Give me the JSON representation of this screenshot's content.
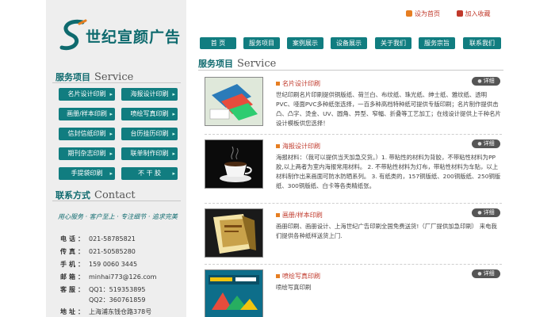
{
  "brand": {
    "name": "世纪宣颜广告"
  },
  "top_links": {
    "home": "设为首页",
    "favorite": "加入收藏"
  },
  "nav": [
    "首  页",
    "服务项目",
    "案例展示",
    "设备展示",
    "关于我们",
    "服务宗旨",
    "联系我们"
  ],
  "service": {
    "title": "服务项目",
    "title_en": "Service",
    "items": [
      "名片设计印刷",
      "海报设计印刷",
      "画册/样本印刷",
      "喷绘写真印刷",
      "信封信纸印刷",
      "台历挂历印刷",
      "期刊杂志印刷",
      "联单制作印刷",
      "手提袋印刷",
      "不 干 胶"
    ]
  },
  "contact": {
    "title": "联系方式",
    "title_en": "Contact",
    "slogan": "用心服务 · 客户至上 · 专注细节 · 追求完美",
    "rows": [
      {
        "k": "电话：",
        "v": "021-58785821"
      },
      {
        "k": "传真：",
        "v": "021-50585280"
      },
      {
        "k": "手机：",
        "v": "159 0060 3445"
      },
      {
        "k": "邮箱：",
        "v": "minhai773@126.com"
      },
      {
        "k": "客服：",
        "v": "QQ1：519353895"
      },
      {
        "k": "",
        "v": "QQ2：360761859"
      },
      {
        "k": "地址：",
        "v": "上海浦东钱仓路378号"
      }
    ]
  },
  "main": {
    "title": "服务项目",
    "title_en": "Service",
    "detail_label": "详细",
    "items": [
      {
        "title": "名片设计印刷",
        "desc": "世纪印刷名片印刷提供铜版纸、荷兰白、布纹纸、珠光纸、绅士纸、雅纹纸、透明PVC、哑面PVC多种纸张选择，一百多种高档特种纸可提供专版印刷；名片制作提供击凸、凸字、烫金、UV、圆角、异型、窄幅、折叠等工艺加工；在线设计提供上千种名片设计模板供您选择！"
      },
      {
        "title": "海报设计印刷",
        "desc": "海报材料：（我可以提供当天加急交货。）1. 带粘性的材料为背胶，不带粘性材料为PP胶,以上两者为室内海报常用材料。 2. 不带粘性材料为灯布，带粘性材料为车贴，以上材料制作出来画面可防水防晒系列。 3. 有纸类的，157铜版纸、200铜版纸、250铜版纸、300铜版纸、白卡等各类精纸张。"
      },
      {
        "title": "画册/样本印刷",
        "desc": "画册印刷、画册设计、上海世纪广告印刷全国免费送货!（厂厂提供加急印刷） 来电我们提供各种纸样送货上门."
      },
      {
        "title": "喷绘写真印刷",
        "desc": "喷绘写真印刷"
      }
    ]
  },
  "colors": {
    "teal": "#117d80",
    "red": "#c0392b",
    "orange": "#e67e22"
  }
}
